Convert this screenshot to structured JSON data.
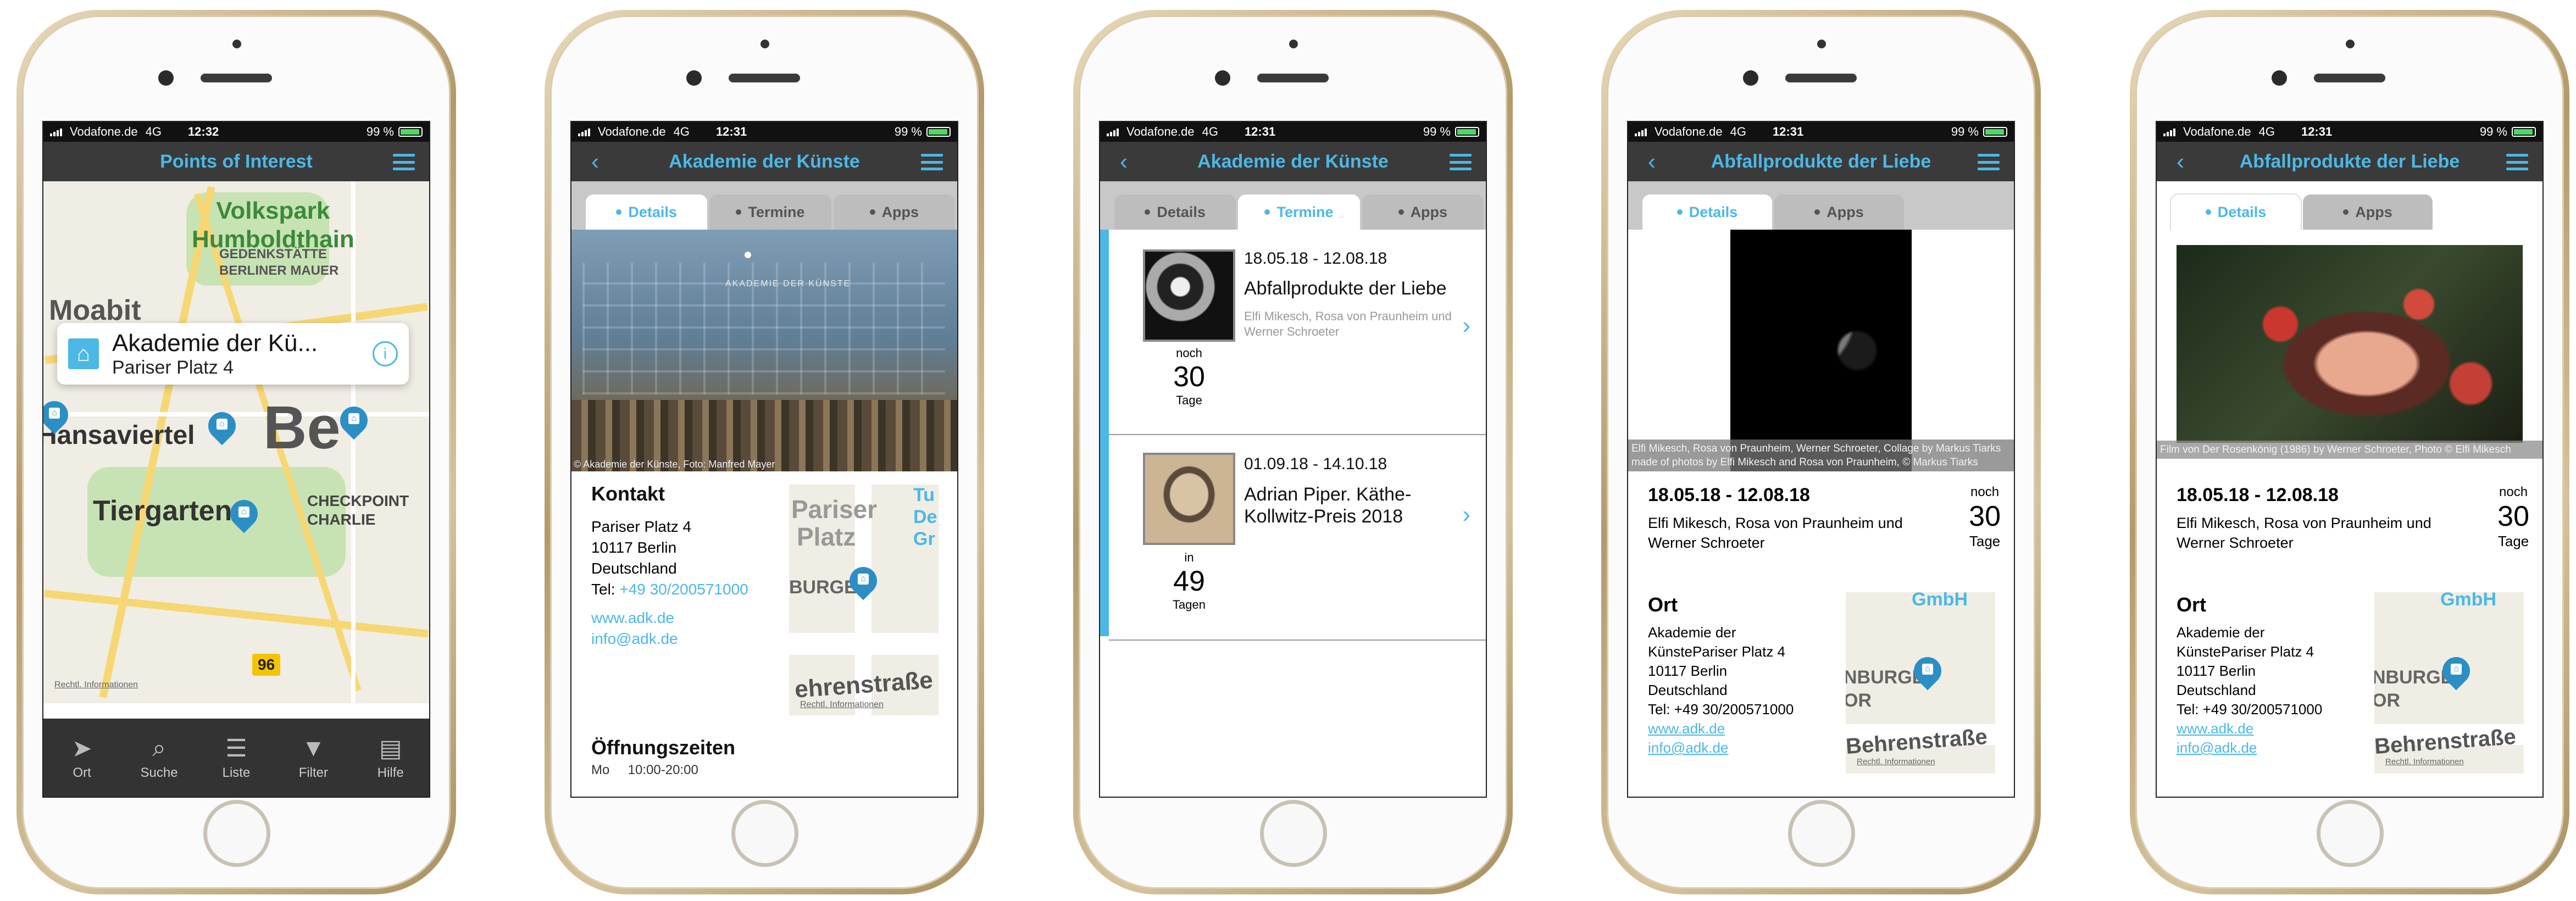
{
  "status": {
    "carrier": "Vodafone.de",
    "network": "4G",
    "time1": "12:32",
    "time": "12:31",
    "battery": "99 %"
  },
  "phone1": {
    "title": "Points of Interest",
    "map_labels": {
      "park": "Volkspark\nHumboldthain",
      "moabit": "Moabit",
      "gedenk": "GEDENKSTÄTTE\nBERLINER MAUER",
      "hansa": "Hansaviertel",
      "tier": "Tiergarten",
      "check": "CHECKPOINT\nCHARLIE",
      "big": "Be",
      "road": "96",
      "legal": "Rechtl. Informationen"
    },
    "callout": {
      "title": "Akademie der Kü...",
      "subtitle": "Pariser Platz 4",
      "info": "i"
    },
    "tabbar": [
      {
        "icon": "location-icon",
        "label": "Ort"
      },
      {
        "icon": "search-icon",
        "label": "Suche"
      },
      {
        "icon": "list-icon",
        "label": "Liste"
      },
      {
        "icon": "filter-icon",
        "label": "Filter"
      },
      {
        "icon": "help-icon",
        "label": "Hilfe"
      }
    ]
  },
  "phone2": {
    "title": "Akademie der Künste",
    "tabs": [
      "Details",
      "Termine",
      "Apps"
    ],
    "photo_credit": "© Akademie der Künste, Foto: Manfred Mayer",
    "building_sign": "AKADEMIE DER KÜNSTE",
    "contact_heading": "Kontakt",
    "address": [
      "Pariser Platz 4",
      "10117 Berlin",
      "Deutschland"
    ],
    "tel_label": "Tel:",
    "tel": "+49 30/200571000",
    "web": "www.adk.de",
    "email": "info@adk.de",
    "map": {
      "t1": "Pariser",
      "t2": "Platz",
      "t3": "Tu",
      "t4": "De",
      "t5": "Gr",
      "t6": "BURGE",
      "t7": "ehrenstraße",
      "legal": "Rechtl. Informationen"
    },
    "hours_heading": "Öffnungszeiten",
    "hours_line": "Mo     10:00-20:00"
  },
  "phone3": {
    "title": "Akademie der Künste",
    "tabs": [
      "Details",
      "Termine",
      "Apps"
    ],
    "events": [
      {
        "dates": "18.05.18 - 12.08.18",
        "title": "Abfallprodukte der Liebe",
        "sub": "Elfi Mikesch, Rosa von Praunheim und Werner Schroeter",
        "pre": "noch",
        "num": "30",
        "unit": "Tage"
      },
      {
        "dates": "01.09.18 - 14.10.18",
        "title": "Adrian Piper. Käthe-Kollwitz-Preis 2018",
        "sub": "",
        "pre": "in",
        "num": "49",
        "unit": "Tagen"
      }
    ]
  },
  "phone4": {
    "title": "Abfallprodukte der Liebe",
    "tabs": [
      "Details",
      "Apps"
    ],
    "caption": "Elfi Mikesch, Rosa von Praunheim, Werner Schroeter, Collage by Markus Tiarks made of photos by Elfi Mikesch and Rosa von Praunheim, © Markus Tiarks",
    "dates": "18.05.18 - 12.08.18",
    "artists": "Elfi Mikesch, Rosa von Praunheim und Werner Schroeter",
    "pre": "noch",
    "num": "30",
    "unit": "Tage",
    "ort_heading": "Ort",
    "address": [
      "Akademie der",
      "KünstePariser Platz 4",
      "10117 Berlin",
      "Deutschland",
      "Tel: +49 30/200571000"
    ],
    "web": "www.adk.de",
    "email": "info@adk.de",
    "map": {
      "t1": "GmbH",
      "t2": "NBURGE",
      "t3": "OR",
      "t4": "Behrenstraße",
      "legal": "Rechtl. Informationen"
    }
  },
  "phone5": {
    "title": "Abfallprodukte der Liebe",
    "tabs": [
      "Details",
      "Apps"
    ],
    "caption": "Film von Der Rosenkönig (1986) by Werner Schroeter, Photo © Elfi Mikesch",
    "dates": "18.05.18 - 12.08.18",
    "artists": "Elfi Mikesch, Rosa von Praunheim und Werner Schroeter",
    "pre": "noch",
    "num": "30",
    "unit": "Tage",
    "ort_heading": "Ort",
    "address": [
      "Akademie der",
      "KünstePariser Platz 4",
      "10117 Berlin",
      "Deutschland",
      "Tel: +49 30/200571000"
    ],
    "web": "www.adk.de",
    "email": "info@adk.de",
    "map": {
      "t1": "GmbH",
      "t2": "NBURGE",
      "t3": "OR",
      "t4": "Behrenstraße",
      "legal": "Rechtl. Informationen"
    }
  },
  "colors": {
    "accent": "#4bb8e6",
    "nav": "#3a3a3a",
    "pin": "#2b8fc6"
  }
}
